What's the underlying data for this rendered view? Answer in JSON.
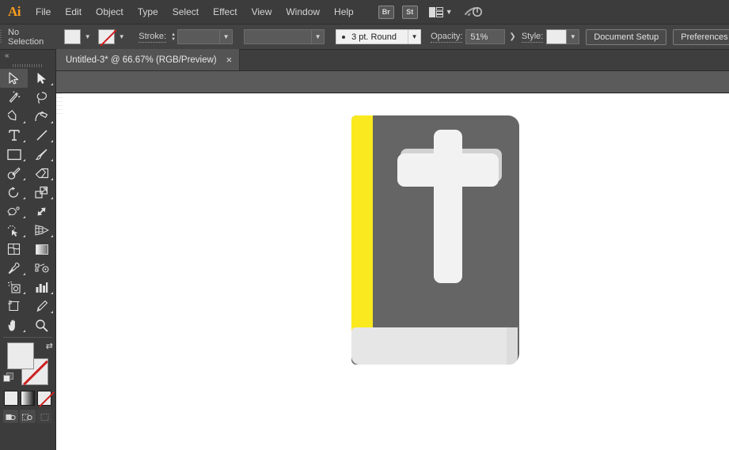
{
  "app": {
    "name": "Adobe Illustrator",
    "logo_text": "Ai"
  },
  "menubar": {
    "items": [
      {
        "label": "File"
      },
      {
        "label": "Edit"
      },
      {
        "label": "Object"
      },
      {
        "label": "Type"
      },
      {
        "label": "Select"
      },
      {
        "label": "Effect"
      },
      {
        "label": "View"
      },
      {
        "label": "Window"
      },
      {
        "label": "Help"
      }
    ],
    "bridge_label": "Br",
    "stock_label": "St",
    "arrange_documents_name": "arrange-documents-icon",
    "sync_settings_name": "sync-settings-icon"
  },
  "controlbar": {
    "selection_status": "No Selection",
    "fill_swatch_color": "#ececec",
    "stroke_swatch_color": "#ececec",
    "stroke_label": "Stroke:",
    "stroke_weight_value": "",
    "stroke_profile_value": "",
    "brush_value": "3 pt. Round",
    "opacity_label": "Opacity:",
    "opacity_value": "51%",
    "style_label": "Style:",
    "style_swatch_color": "#ececec",
    "document_setup_label": "Document Setup",
    "preferences_label": "Preferences"
  },
  "tabbar": {
    "tab_title": "Untitled-3* @ 66.67% (RGB/Preview)",
    "close_glyph": "×"
  },
  "toolbar": {
    "collapse_glyph": "«",
    "tools": [
      {
        "name": "selection-tool",
        "active": true,
        "corner": false
      },
      {
        "name": "direct-selection-tool",
        "active": false,
        "corner": true
      },
      {
        "name": "magic-wand-tool",
        "active": false,
        "corner": false
      },
      {
        "name": "lasso-tool",
        "active": false,
        "corner": false
      },
      {
        "name": "pen-tool",
        "active": false,
        "corner": true
      },
      {
        "name": "curvature-tool",
        "active": false,
        "corner": true
      },
      {
        "name": "type-tool",
        "active": false,
        "corner": true
      },
      {
        "name": "line-segment-tool",
        "active": false,
        "corner": true
      },
      {
        "name": "rectangle-tool",
        "active": false,
        "corner": true
      },
      {
        "name": "paintbrush-tool",
        "active": false,
        "corner": true
      },
      {
        "name": "shaper-tool",
        "active": false,
        "corner": true
      },
      {
        "name": "eraser-tool",
        "active": false,
        "corner": true
      },
      {
        "name": "rotate-tool",
        "active": false,
        "corner": true
      },
      {
        "name": "scale-tool",
        "active": false,
        "corner": true
      },
      {
        "name": "width-tool",
        "active": false,
        "corner": true
      },
      {
        "name": "free-transform-tool",
        "active": false,
        "corner": false
      },
      {
        "name": "shape-builder-tool",
        "active": false,
        "corner": true
      },
      {
        "name": "perspective-grid-tool",
        "active": false,
        "corner": true
      },
      {
        "name": "mesh-tool",
        "active": false,
        "corner": false
      },
      {
        "name": "gradient-tool",
        "active": false,
        "corner": false
      },
      {
        "name": "eyedropper-tool",
        "active": false,
        "corner": true
      },
      {
        "name": "blend-tool",
        "active": false,
        "corner": false
      },
      {
        "name": "symbol-sprayer-tool",
        "active": false,
        "corner": true
      },
      {
        "name": "column-graph-tool",
        "active": false,
        "corner": true
      },
      {
        "name": "artboard-tool",
        "active": false,
        "corner": false
      },
      {
        "name": "slice-tool",
        "active": false,
        "corner": true
      },
      {
        "name": "hand-tool",
        "active": false,
        "corner": true
      },
      {
        "name": "zoom-tool",
        "active": false,
        "corner": false
      }
    ],
    "fill_color": "#ebebeb",
    "stroke_color": "none",
    "swap_glyph": "⇄",
    "mode_color_name": "color-mode-button",
    "mode_gradient_name": "gradient-mode-button",
    "mode_none_name": "none-mode-button",
    "draw_normal_name": "draw-normal-button",
    "draw_behind_name": "draw-behind-button",
    "draw_inside_name": "draw-inside-button"
  },
  "artwork": {
    "title": "bible-book-illustration",
    "cover_color": "#656565",
    "spine_color": "#fae91e",
    "pages_color": "#e6e6e6",
    "pages_edge_color": "#dcdcdc",
    "cross_color": "#f2f2f2",
    "cross_shadow_color": "#d2d2d2"
  }
}
